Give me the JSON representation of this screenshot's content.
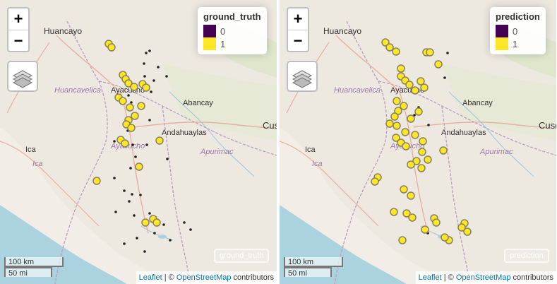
{
  "colors": {
    "class_0": "#440154",
    "class_1": "#FDE725",
    "point_dark": "#222222",
    "ring": "#8a8060"
  },
  "zoom_control": {
    "in_label": "+",
    "out_label": "−"
  },
  "layers_control": {
    "icon": "layers-icon"
  },
  "places": [
    "Huancayo",
    "Huancavelica",
    "Ayacucho",
    "Abancay",
    "Andahuaylas",
    "Apurimac",
    "Cusco",
    "Ica"
  ],
  "scale": {
    "metric": "100 km",
    "imperial": "50 mi"
  },
  "attribution": {
    "leaflet": "Leaflet",
    "sep": " | © ",
    "osm": "OpenStreetMap",
    "suffix": " contributors"
  },
  "maps": [
    {
      "legend": {
        "title": "ground_truth",
        "items": [
          "0",
          "1"
        ]
      },
      "layer_label": "ground_truth"
    },
    {
      "legend": {
        "title": "prediction",
        "items": [
          "0",
          "1"
        ]
      },
      "layer_label": "prediction"
    }
  ]
}
